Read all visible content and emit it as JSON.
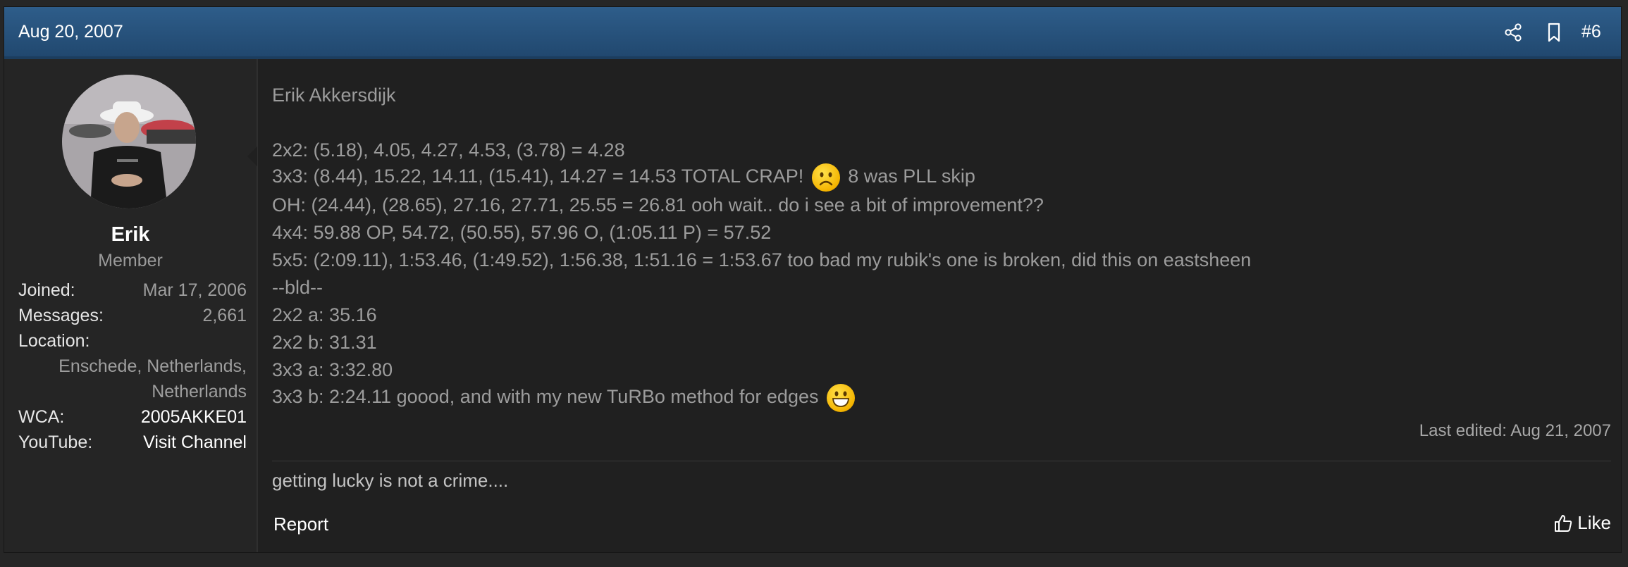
{
  "header": {
    "date": "Aug 20, 2007",
    "share_icon": "share-icon",
    "bookmark_icon": "bookmark-icon",
    "post_number": "#6"
  },
  "user": {
    "name": "Erik",
    "title": "Member",
    "stats": {
      "joined_label": "Joined:",
      "joined_value": "Mar 17, 2006",
      "messages_label": "Messages:",
      "messages_value": "2,661",
      "location_label": "Location:",
      "location_value_1": "Enschede, Netherlands,",
      "location_value_2": "Netherlands",
      "wca_label": "WCA:",
      "wca_value": "2005AKKE01",
      "youtube_label": "YouTube:",
      "youtube_value": "Visit Channel"
    }
  },
  "message": {
    "lines": [
      "Erik Akkersdijk",
      "2x2: (5.18), 4.05, 4.27, 4.53, (3.78) = 4.28",
      "3x3: (8.44), 15.22, 14.11, (15.41), 14.27 = 14.53 TOTAL CRAP!",
      "8 was PLL skip",
      "OH: (24.44), (28.65), 27.16, 27.71, 25.55 = 26.81 ooh wait.. do i see a bit of improvement??",
      "4x4: 59.88 OP, 54.72, (50.55), 57.96 O, (1:05.11 P) = 57.52",
      "5x5: (2:09.11), 1:53.46, (1:49.52), 1:56.38, 1:51.16 = 1:53.67 too bad my rubik's one is broken, did this on eastsheen",
      "--bld--",
      "2x2 a: 35.16",
      "2x2 b: 31.31",
      "3x3 a: 3:32.80",
      "3x3 b: 2:24.11 goood, and with my new TuRBo method for edges"
    ],
    "smilies": [
      "frown-smilie-icon",
      "grin-smilie-icon"
    ],
    "last_edited": "Last edited: Aug 21, 2007",
    "signature": "getting lucky is not a crime...."
  },
  "actions": {
    "report": "Report",
    "like": "Like",
    "like_icon": "thumbs-up-icon"
  },
  "colors": {
    "header": "#2a5683",
    "background": "#202020",
    "sidebar": "#252525"
  }
}
